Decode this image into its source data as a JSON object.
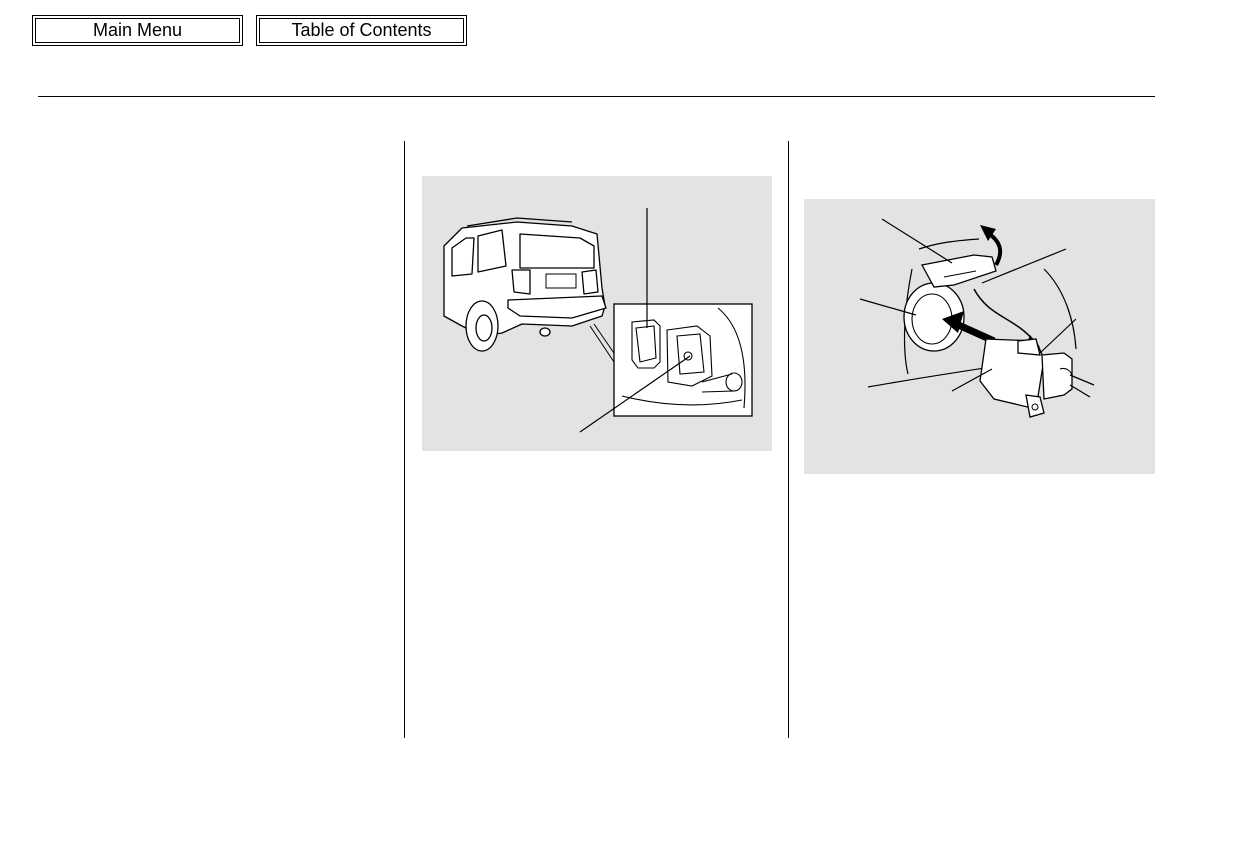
{
  "nav": {
    "main_menu_label": "Main Menu",
    "toc_label": "Table of Contents"
  }
}
